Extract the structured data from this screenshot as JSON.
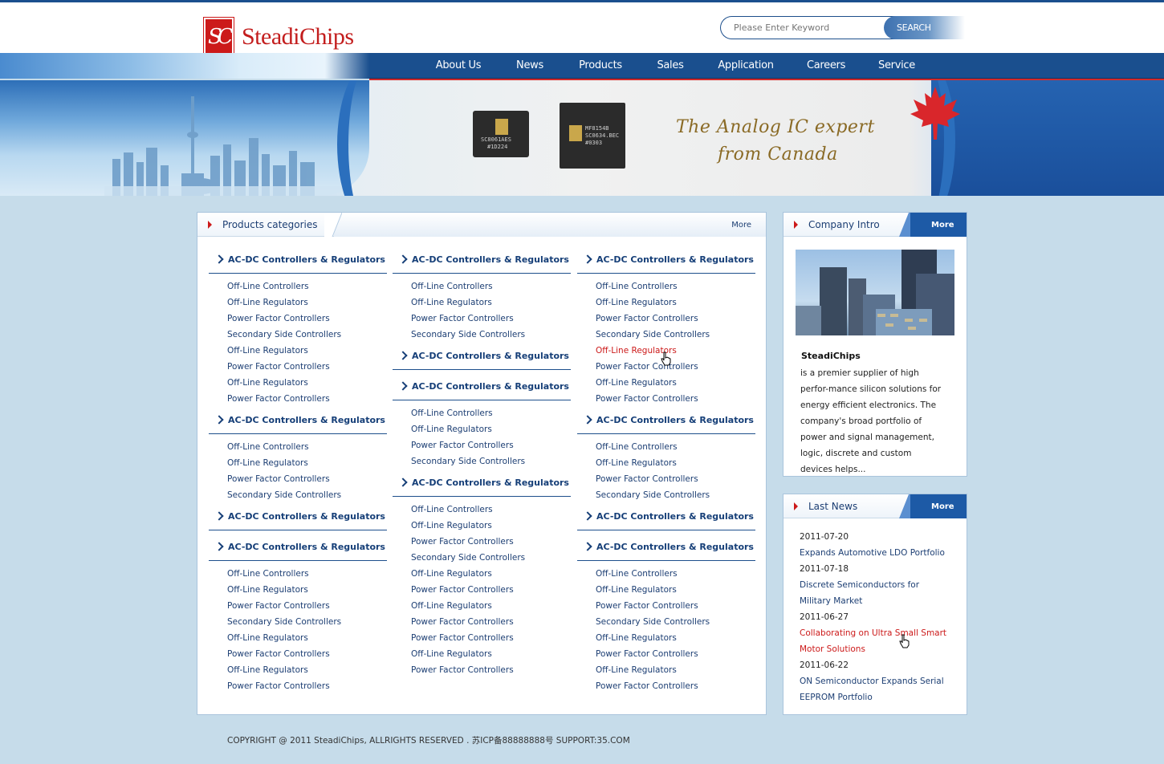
{
  "brand": {
    "name": "SteadiChips",
    "mark": "SC"
  },
  "search": {
    "placeholder": "Please Enter Keyword",
    "button": "SEARCH"
  },
  "nav": [
    "About Us",
    "News",
    "Products",
    "Sales",
    "Application",
    "Careers",
    "Service"
  ],
  "banner": {
    "slogan_line1": "The Analog IC expert",
    "slogan_line2": "from Canada",
    "chip1": {
      "line1": "SC8061AES",
      "line2": "#1D224"
    },
    "chip2": {
      "line1": "MF8154B",
      "line2": "SC0634.BEC",
      "line3": "#0303"
    }
  },
  "products": {
    "title": "Products categories",
    "more": "More",
    "columns": [
      [
        {
          "title": "AC-DC Controllers & Regulators",
          "items": [
            "Off-Line Controllers",
            "Off-Line Regulators",
            "Power Factor Controllers",
            "Secondary Side Controllers",
            "Off-Line Regulators",
            "Power Factor Controllers",
            "Off-Line Regulators",
            "Power Factor Controllers"
          ]
        },
        {
          "title": "AC-DC Controllers & Regulators",
          "items": [
            "Off-Line Controllers",
            "Off-Line Regulators",
            "Power Factor Controllers",
            "Secondary Side Controllers"
          ]
        },
        {
          "title": "AC-DC Controllers & Regulators",
          "items": []
        },
        {
          "title": "AC-DC Controllers & Regulators",
          "items": [
            "Off-Line Controllers",
            "Off-Line Regulators",
            "Power Factor Controllers",
            "Secondary Side Controllers",
            "Off-Line Regulators",
            "Power Factor Controllers",
            "Off-Line Regulators",
            "Power Factor Controllers"
          ]
        }
      ],
      [
        {
          "title": "AC-DC Controllers & Regulators",
          "items": [
            "Off-Line Controllers",
            "Off-Line Regulators",
            "Power Factor Controllers",
            "Secondary Side Controllers"
          ]
        },
        {
          "title": "AC-DC Controllers & Regulators",
          "items": []
        },
        {
          "title": "AC-DC Controllers & Regulators",
          "items": [
            "Off-Line Controllers",
            "Off-Line Regulators",
            "Power Factor Controllers",
            "Secondary Side Controllers"
          ]
        },
        {
          "title": "AC-DC Controllers & Regulators",
          "items": [
            "Off-Line Controllers",
            "Off-Line Regulators",
            "Power Factor Controllers",
            "Secondary Side Controllers",
            "Off-Line Regulators",
            "Power Factor Controllers",
            "Off-Line Regulators",
            "Power Factor Controllers",
            "Power Factor Controllers",
            "Off-Line Regulators",
            "Power Factor Controllers"
          ]
        }
      ],
      [
        {
          "title": "AC-DC Controllers & Regulators",
          "items": [
            "Off-Line Controllers",
            "Off-Line Regulators",
            "Power Factor Controllers",
            "Secondary Side Controllers",
            "Off-Line Regulators",
            "Power Factor Controllers",
            "Off-Line Regulators",
            "Power Factor Controllers"
          ]
        },
        {
          "title": "AC-DC Controllers & Regulators",
          "items": [
            "Off-Line Controllers",
            "Off-Line Regulators",
            "Power Factor Controllers",
            "Secondary Side Controllers"
          ]
        },
        {
          "title": "AC-DC Controllers & Regulators",
          "items": []
        },
        {
          "title": "AC-DC Controllers & Regulators",
          "items": [
            "Off-Line Controllers",
            "Off-Line Regulators",
            "Power Factor Controllers",
            "Secondary Side Controllers",
            "Off-Line Regulators",
            "Power Factor Controllers",
            "Off-Line Regulators",
            "Power Factor Controllers"
          ]
        }
      ]
    ]
  },
  "intro": {
    "title": "Company Intro",
    "more": "More",
    "name": "SteadiChips",
    "text": "is a premier supplier of high perfor-mance silicon solutions for energy efficient electronics. The company's broad portfolio of power and signal management, logic, discrete and custom devices helps..."
  },
  "news": {
    "title": "Last News",
    "more": "More",
    "items": [
      {
        "date": "2011-07-20",
        "title": "Expands Automotive LDO Portfolio"
      },
      {
        "date": "2011-07-18",
        "title": "Discrete Semiconductors for Military Market"
      },
      {
        "date": "2011-06-27",
        "title": "Collaborating on Ultra Small Smart Motor Solutions"
      },
      {
        "date": "2011-06-22",
        "title": "ON Semiconductor Expands Serial EEPROM Portfolio"
      }
    ]
  },
  "footer": "COPYRIGHT  @ 2011 SteadiChips, ALLRIGHTS RESERVED .   苏ICP备88888888号    SUPPORT:35.COM",
  "colors": {
    "navy": "#1a4f8e",
    "accent_red": "#cc1a1a",
    "link": "#1c3e73",
    "page_bg": "#c6dcea"
  }
}
